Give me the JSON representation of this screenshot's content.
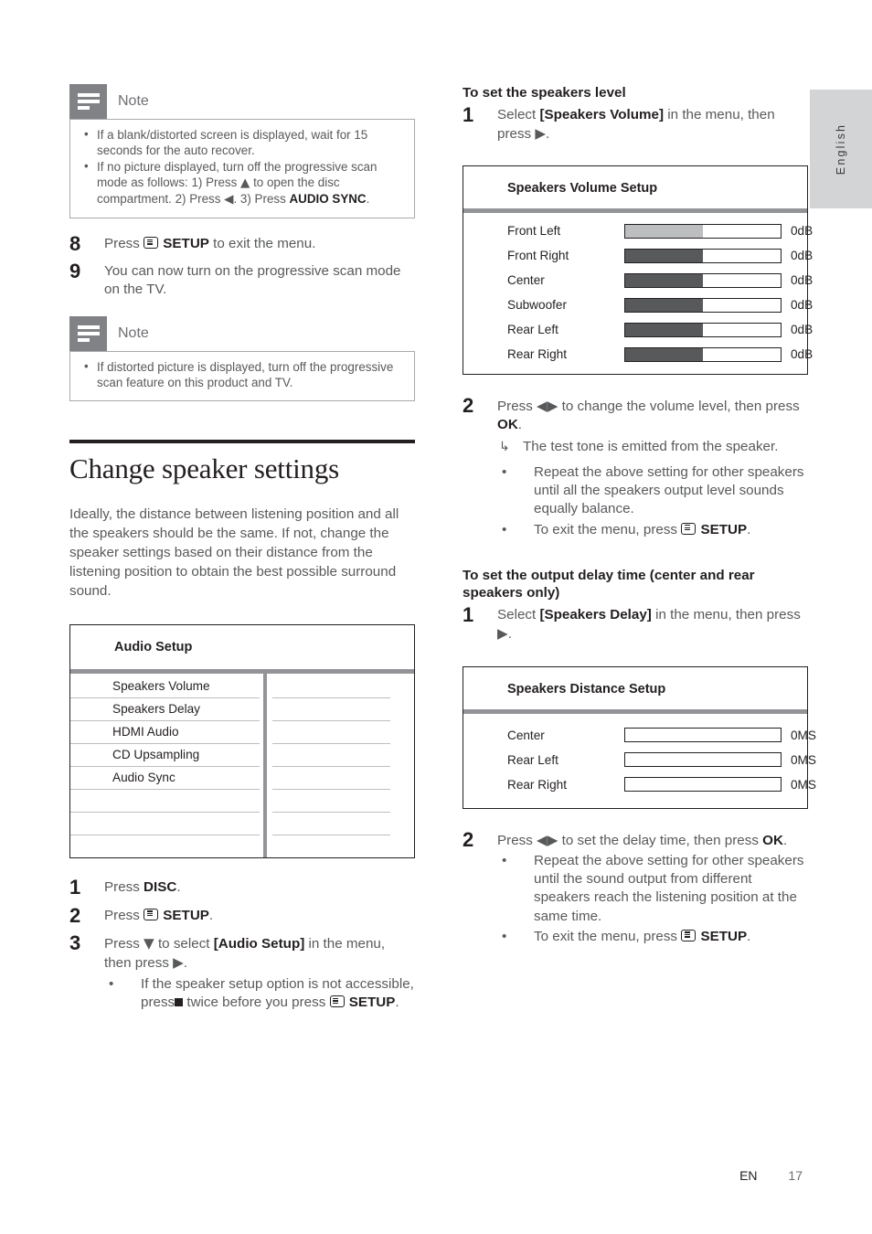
{
  "language_tab": {
    "label": "English"
  },
  "footer": {
    "edition": "EN",
    "page": "17"
  },
  "left_column": {
    "note1": {
      "icon": "note-icon",
      "title": "Note",
      "bullets": [
        "If a blank/distorted screen is displayed, wait for 15 seconds for the auto recover.",
        "If no picture displayed, turn off the progressive scan mode as follows: 1) Press ▲ to open the disc compartment. 2) Press ◀. 3) Press AUDIO SYNC."
      ]
    },
    "steps_top": [
      {
        "num": "8",
        "text": "Press ☰ SETUP to exit the menu."
      },
      {
        "num": "9",
        "text": "You can now turn on the progressive scan mode on the TV."
      }
    ],
    "note2": {
      "icon": "note-icon",
      "title": "Note",
      "bullets": [
        "If distorted picture is displayed, turn off the progressive scan feature on this product and TV."
      ]
    },
    "section": {
      "title": "Change speaker settings",
      "paragraph": "Ideally, the distance between listening position and all the speakers should be the same. If not, change the speaker settings based on their distance from the listening position to obtain the best possible surround sound."
    },
    "audio_setup_menu": {
      "title": "Audio Setup",
      "items": [
        "Speakers Volume",
        "Speakers Delay",
        "HDMI Audio",
        "CD Upsampling",
        "Audio Sync",
        "",
        "",
        ""
      ]
    },
    "steps_bottom": [
      {
        "num": "1",
        "text": "Press DISC."
      },
      {
        "num": "2",
        "text": "Press ☰ SETUP."
      },
      {
        "num": "3",
        "text": "Press ▼ to select [Audio Setup] in the menu, then press ▶.",
        "bullets": [
          "If the speaker setup option is not accessible, press ■ twice before you press ☰ SETUP."
        ]
      }
    ]
  },
  "right_column": {
    "subhead1": "To set the speakers level",
    "step1": {
      "num": "1",
      "text": "Select [Speakers Volume] in the menu, then press ▶."
    },
    "volume_setup": {
      "title": "Speakers Volume Setup",
      "rows": [
        {
          "label": "Front Left",
          "value": "0dB",
          "fill_percent": 50,
          "highlighted": true
        },
        {
          "label": "Front Right",
          "value": "0dB",
          "fill_percent": 50,
          "highlighted": false
        },
        {
          "label": "Center",
          "value": "0dB",
          "fill_percent": 50,
          "highlighted": false
        },
        {
          "label": "Subwoofer",
          "value": "0dB",
          "fill_percent": 50,
          "highlighted": false
        },
        {
          "label": "Rear Left",
          "value": "0dB",
          "fill_percent": 50,
          "highlighted": false
        },
        {
          "label": "Rear Right",
          "value": "0dB",
          "fill_percent": 50,
          "highlighted": false
        }
      ]
    },
    "step2": {
      "num": "2",
      "text": "Press ◀▶ to change the volume level, then press OK.",
      "arrow_note": "The test tone is emitted from the speaker.",
      "bullets": [
        "Repeat the above setting for other speakers until all the speakers output level sounds equally balance.",
        "To exit the menu, press ☰ SETUP."
      ]
    },
    "subhead2": "To set the output delay time (center and rear speakers only)",
    "step3": {
      "num": "1",
      "text": "Select [Speakers Delay] in the menu, then press ▶."
    },
    "distance_setup": {
      "title": "Speakers Distance Setup",
      "rows": [
        {
          "label": "Center",
          "value": "0MS",
          "fill_percent": 0
        },
        {
          "label": "Rear Left",
          "value": "0MS",
          "fill_percent": 0
        },
        {
          "label": "Rear Right",
          "value": "0MS",
          "fill_percent": 0
        }
      ]
    },
    "step4": {
      "num": "2",
      "text": "Press ◀▶ to set the delay time, then press OK.",
      "bullets": [
        "Repeat the above setting for other speakers until the sound output from different speakers reach the listening position at the same time.",
        "To exit the menu, press ☰ SETUP."
      ]
    }
  },
  "colors": {
    "text": "#58595b",
    "heading": "#231f20",
    "note_icon_bg": "#808285",
    "rule": "#929497",
    "bar_fill": "#58595b",
    "bar_fill_highlight": "#bcbec0",
    "tab_bg": "#d3d4d6"
  }
}
